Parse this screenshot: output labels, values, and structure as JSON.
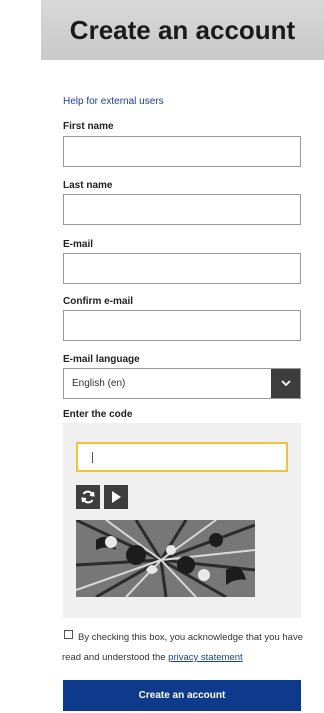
{
  "page": {
    "title": "Create an account"
  },
  "help_link": "Help for external users",
  "fields": {
    "first_name": {
      "label": "First name",
      "value": ""
    },
    "last_name": {
      "label": "Last name",
      "value": ""
    },
    "email": {
      "label": "E-mail",
      "value": ""
    },
    "confirm_email": {
      "label": "Confirm e-mail",
      "value": ""
    },
    "email_language": {
      "label": "E-mail language",
      "selected": "English (en)"
    },
    "code": {
      "label": "Enter the code",
      "value": ""
    }
  },
  "captcha": {
    "refresh_icon": "refresh-icon",
    "play_icon": "play-icon"
  },
  "consent": {
    "text": "By checking this box, you acknowledge that you have read and understood the",
    "link": "privacy statement"
  },
  "submit_label": "Create an account",
  "colors": {
    "title_bg": "#cfcfcf",
    "link": "#1a3e9c",
    "primary": "#0e3a8c",
    "captcha_input_border": "#f2c23a",
    "icon_button_bg": "#3d3d3d"
  }
}
